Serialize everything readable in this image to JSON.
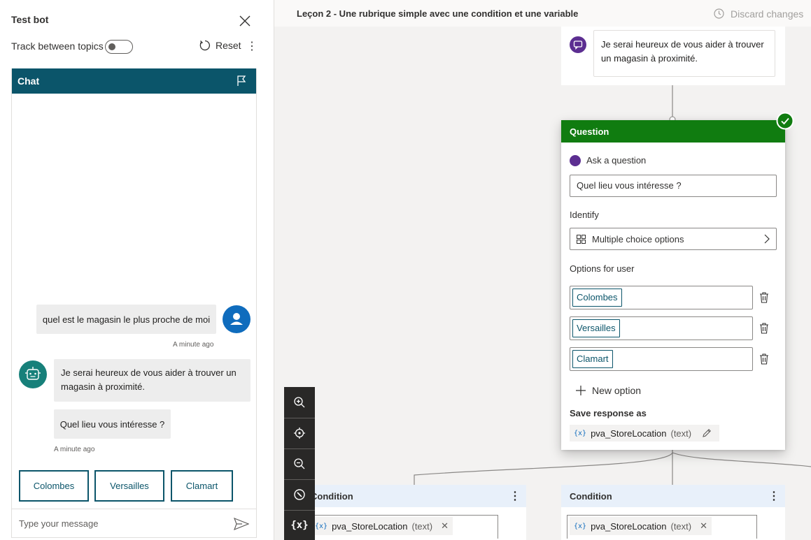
{
  "testbot": {
    "title": "Test bot",
    "track_label": "Track between topics",
    "reset_label": "Reset"
  },
  "chat": {
    "header_title": "Chat",
    "user_message": "quel est le magasin le plus proche de moi",
    "user_timestamp": "A minute ago",
    "bot_message_1": "Je serai heureux de vous aider à trouver un magasin à proximité.",
    "bot_message_2": "Quel lieu vous intéresse ?",
    "bot_timestamp": "A minute ago",
    "suggestions": [
      "Colombes",
      "Versailles",
      "Clamart"
    ],
    "input_placeholder": "Type your message"
  },
  "canvas": {
    "page_title": "Leçon 2 - Une rubrique simple avec une condition et une variable",
    "discard_label": "Discard changes",
    "message_node_text": "Je serai heureux de vous aider à trouver un magasin à proximité.",
    "question_node": {
      "header": "Question",
      "ask_label": "Ask a question",
      "question_text": "Quel lieu vous intéresse ?",
      "identify_label": "Identify",
      "identify_value": "Multiple choice options",
      "options_label": "Options for user",
      "options": [
        "Colombes",
        "Versailles",
        "Clamart"
      ],
      "new_option_label": "New option",
      "save_label": "Save response as",
      "variable_name": "pva_StoreLocation",
      "variable_type": "(text)",
      "variable_icon": "{x}"
    },
    "conditions": [
      {
        "header": "Condition",
        "variable_name": "pva_StoreLocation",
        "variable_type": "(text)",
        "variable_icon": "{x}"
      },
      {
        "header": "Condition",
        "variable_name": "pva_StoreLocation",
        "variable_type": "(text)",
        "variable_icon": "{x}"
      }
    ],
    "zoom_variable_label": "{x}"
  },
  "colors": {
    "chat_header": "#0b556a",
    "question_header": "#107c10",
    "condition_header": "#e8f0fa",
    "user_avatar": "#0f6cbd",
    "bot_avatar": "#17807a",
    "message_icon": "#5c2e91"
  },
  "icons": {
    "close": "close-icon",
    "reset": "refresh-icon",
    "flag": "flag-icon",
    "send": "send-icon",
    "discard": "history-icon",
    "trash": "trash-icon",
    "add": "plus-icon",
    "edit": "pencil-icon",
    "check": "check-circle-icon",
    "zoom_in": "zoom-in-icon",
    "recenter": "recenter-icon",
    "zoom_out": "zoom-out-icon",
    "minimap": "compass-icon"
  }
}
